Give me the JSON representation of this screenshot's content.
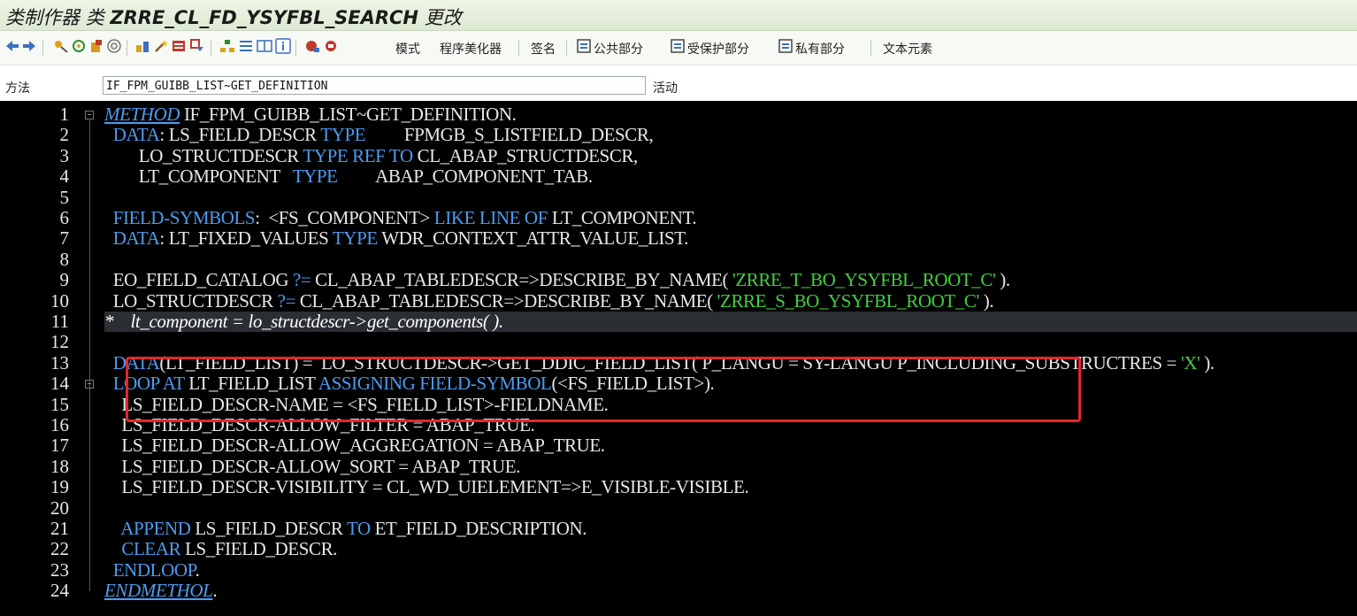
{
  "window": {
    "title_prefix": "类制作器 类",
    "class_name": "ZRRE_CL_FD_YSYFBL_SEARCH",
    "title_suffix": "更改"
  },
  "toolbar": {
    "mode_label": "模式",
    "pretty_printer_label": "程序美化器",
    "signature_label": "签名",
    "public_section_label": "公共部分",
    "protected_section_label": "受保护部分",
    "private_section_label": "私有部分",
    "text_elements_label": "文本元素"
  },
  "method_bar": {
    "label": "方法",
    "value": "IF_FPM_GUIBB_LIST~GET_DEFINITION",
    "status": "活动"
  },
  "editor": {
    "lines": [
      {
        "no": "1",
        "tokens": [
          {
            "t": "METHOD",
            "c": "kwi"
          },
          {
            "t": " IF_FPM_GUIBB_LIST~GET_DEFINITION.",
            "c": ""
          }
        ]
      },
      {
        "no": "2",
        "tokens": [
          {
            "t": "  DATA",
            "c": "kw"
          },
          {
            "t": ": LS_FIELD_DESCR ",
            "c": ""
          },
          {
            "t": "TYPE",
            "c": "kw"
          },
          {
            "t": "         FPMGB_S_LISTFIELD_DESCR,",
            "c": ""
          }
        ]
      },
      {
        "no": "3",
        "tokens": [
          {
            "t": "        LO_STRUCTDESCR ",
            "c": ""
          },
          {
            "t": "TYPE REF TO",
            "c": "kw"
          },
          {
            "t": " CL_ABAP_STRUCTDESCR,",
            "c": ""
          }
        ]
      },
      {
        "no": "4",
        "tokens": [
          {
            "t": "        LT_COMPONENT   ",
            "c": ""
          },
          {
            "t": "TYPE",
            "c": "kw"
          },
          {
            "t": "         ABAP_COMPONENT_TAB.",
            "c": ""
          }
        ]
      },
      {
        "no": "5",
        "tokens": []
      },
      {
        "no": "6",
        "tokens": [
          {
            "t": "  FIELD-SYMBOLS",
            "c": "kw"
          },
          {
            "t": ":  <FS_COMPONENT> ",
            "c": ""
          },
          {
            "t": "LIKE LINE OF",
            "c": "kw"
          },
          {
            "t": " LT_COMPONENT.",
            "c": ""
          }
        ]
      },
      {
        "no": "7",
        "tokens": [
          {
            "t": "  DATA",
            "c": "kw"
          },
          {
            "t": ": LT_FIXED_VALUES ",
            "c": ""
          },
          {
            "t": "TYPE",
            "c": "kw"
          },
          {
            "t": " WDR_CONTEXT_ATTR_VALUE_LIST.",
            "c": ""
          }
        ]
      },
      {
        "no": "8",
        "tokens": []
      },
      {
        "no": "9",
        "tokens": [
          {
            "t": "  EO_FIELD_CATALOG ",
            "c": ""
          },
          {
            "t": "?=",
            "c": "kw"
          },
          {
            "t": " CL_ABAP_TABLEDESCR=>DESCRIBE_BY_NAME( ",
            "c": ""
          },
          {
            "t": "'ZRRE_T_BO_YSYFBL_ROOT_C'",
            "c": "str"
          },
          {
            "t": " ).",
            "c": ""
          }
        ]
      },
      {
        "no": "10",
        "tokens": [
          {
            "t": "  LO_STRUCTDESCR ",
            "c": ""
          },
          {
            "t": "?=",
            "c": "kw"
          },
          {
            "t": " CL_ABAP_TABLEDESCR=>DESCRIBE_BY_NAME( ",
            "c": ""
          },
          {
            "t": "'ZRRE_S_BO_YSYFBL_ROOT_C'",
            "c": "str"
          },
          {
            "t": " ).",
            "c": ""
          }
        ]
      },
      {
        "no": "11",
        "comment": true,
        "tokens": [
          {
            "t": "*    lt_component = lo_structdescr->get_components( ).",
            "c": "cmt"
          }
        ]
      },
      {
        "no": "12",
        "tokens": []
      },
      {
        "no": "13",
        "tokens": [
          {
            "t": "  DATA",
            "c": "kw"
          },
          {
            "t": "(LT_FIELD_LIST) =  LO_STRUCTDESCR->GET_DDIC_FIELD_LIST( P_LANGU = SY-LANGU P_INCLUDING_SUBSTRUCTRES = ",
            "c": ""
          },
          {
            "t": "'X'",
            "c": "str"
          },
          {
            "t": " ).",
            "c": ""
          }
        ]
      },
      {
        "no": "14",
        "tokens": [
          {
            "t": "  LOOP AT",
            "c": "kw"
          },
          {
            "t": " LT_FIELD_LIST ",
            "c": ""
          },
          {
            "t": "ASSIGNING FIELD-SYMBOL",
            "c": "kw"
          },
          {
            "t": "(<FS_FIELD_LIST>).",
            "c": ""
          }
        ]
      },
      {
        "no": "15",
        "tokens": [
          {
            "t": "    LS_FIELD_DESCR-NAME = <FS_FIELD_LIST>-FIELDNAME.",
            "c": ""
          }
        ]
      },
      {
        "no": "16",
        "tokens": [
          {
            "t": "    LS_FIELD_DESCR-ALLOW_FILTER = ABAP_TRUE.",
            "c": ""
          }
        ]
      },
      {
        "no": "17",
        "tokens": [
          {
            "t": "    LS_FIELD_DESCR-ALLOW_AGGREGATION = ABAP_TRUE.",
            "c": ""
          }
        ]
      },
      {
        "no": "18",
        "tokens": [
          {
            "t": "    LS_FIELD_DESCR-ALLOW_SORT = ABAP_TRUE.",
            "c": ""
          }
        ]
      },
      {
        "no": "19",
        "tokens": [
          {
            "t": "    LS_FIELD_DESCR-VISIBILITY = CL_WD_UIELEMENT=>E_VISIBLE-VISIBLE.",
            "c": ""
          }
        ]
      },
      {
        "no": "20",
        "tokens": []
      },
      {
        "no": "21",
        "tokens": [
          {
            "t": "    APPEND",
            "c": "kw"
          },
          {
            "t": " LS_FIELD_DESCR ",
            "c": ""
          },
          {
            "t": "TO",
            "c": "kw"
          },
          {
            "t": " ET_FIELD_DESCRIPTION.",
            "c": ""
          }
        ]
      },
      {
        "no": "22",
        "tokens": [
          {
            "t": "    CLEAR",
            "c": "kw"
          },
          {
            "t": " LS_FIELD_DESCR.",
            "c": ""
          }
        ]
      },
      {
        "no": "23",
        "tokens": [
          {
            "t": "  ENDLOOP",
            "c": "kw"
          },
          {
            "t": ".",
            "c": ""
          }
        ]
      },
      {
        "no": "24",
        "tokens": [
          {
            "t": "ENDMETHOL",
            "c": "kwi"
          },
          {
            "t": ".",
            "c": ""
          }
        ]
      }
    ]
  },
  "colors": {
    "keyword": "#4a9df0",
    "string": "#3fd23a",
    "editor_bg": "#000000",
    "highlight_box": "#e8252b"
  }
}
